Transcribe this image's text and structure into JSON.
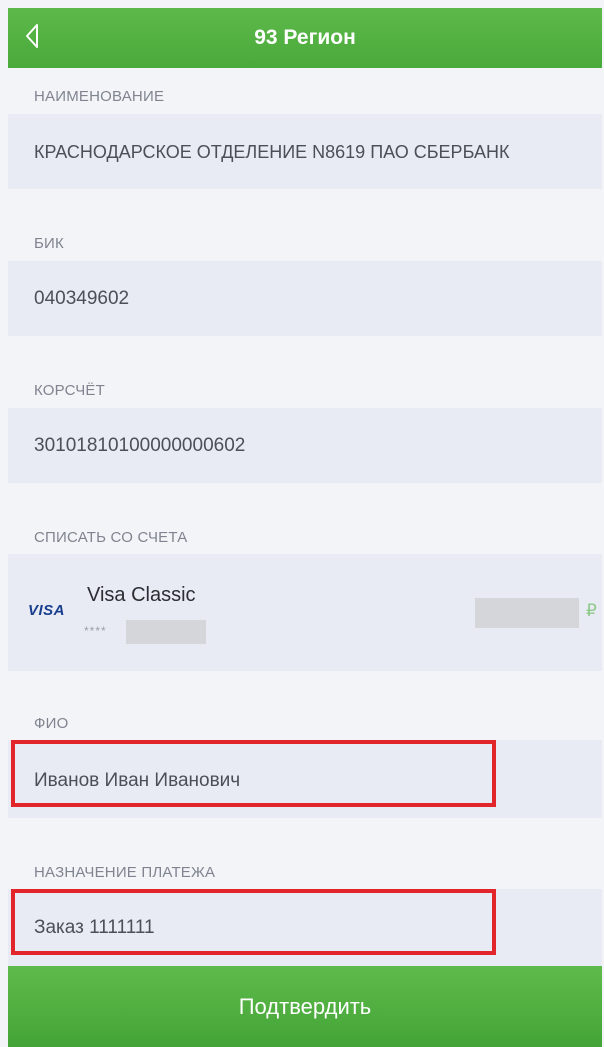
{
  "header": {
    "title": "93 Регион",
    "back_icon": "back-chevron-icon"
  },
  "sections": {
    "name": {
      "label": "НАИМЕНОВАНИЕ",
      "value": "КРАСНОДАРСКОЕ ОТДЕЛЕНИЕ N8619 ПАО СБЕРБАНК"
    },
    "bik": {
      "label": "БИК",
      "value": "040349602"
    },
    "corr_account": {
      "label": "КОРСЧЁТ",
      "value": "30101810100000000602"
    },
    "debit_account": {
      "label": "СПИСАТЬ СО СЧЕТА",
      "card_brand": "VISA",
      "card_name": "Visa Classic",
      "card_mask": "****",
      "currency_symbol": "₽"
    },
    "fio": {
      "label": "ФИО",
      "value": "Иванов Иван Иванович"
    },
    "purpose": {
      "label": "НАЗНАЧЕНИЕ ПЛАТЕЖА",
      "value": "Заказ 1111111"
    }
  },
  "footer": {
    "confirm_label": "Подтвердить"
  },
  "colors": {
    "brand_green": "#4aa93b",
    "highlight_red": "#e2242b",
    "field_bg": "#e8ebf3"
  }
}
